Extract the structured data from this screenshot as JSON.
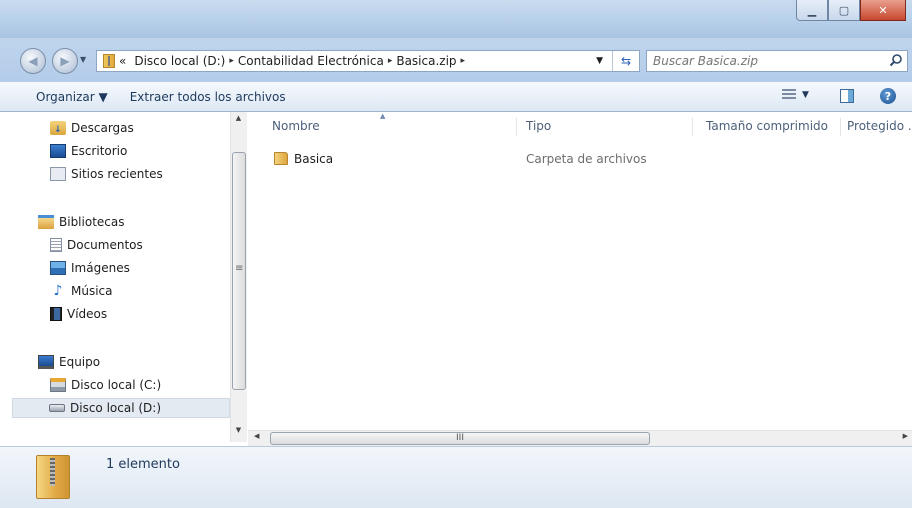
{
  "window": {
    "title": "",
    "minimize_glyph": "▁",
    "maximize_glyph": "▢",
    "close_glyph": "✕"
  },
  "nav": {
    "back_icon": "back-arrow-icon",
    "forward_icon": "forward-arrow-icon"
  },
  "address": {
    "overflow": "«",
    "segments": [
      "Disco local (D:)",
      "Contabilidad Electrónica",
      "Basica.zip"
    ],
    "separator": "▸"
  },
  "search": {
    "placeholder": "Buscar Basica.zip"
  },
  "toolbar": {
    "organize": "Organizar ▼",
    "extract_all": "Extraer todos los archivos",
    "view_dropdown": "▼"
  },
  "sidebar": {
    "items": [
      {
        "label": "Descargas",
        "icon": "downloads-folder-icon"
      },
      {
        "label": "Escritorio",
        "icon": "desktop-icon"
      },
      {
        "label": "Sitios recientes",
        "icon": "recent-places-icon"
      },
      {
        "label": "Bibliotecas",
        "icon": "libraries-icon"
      },
      {
        "label": "Documentos",
        "icon": "documents-icon"
      },
      {
        "label": "Imágenes",
        "icon": "pictures-icon"
      },
      {
        "label": "Música",
        "icon": "music-icon"
      },
      {
        "label": "Vídeos",
        "icon": "videos-icon"
      },
      {
        "label": "Equipo",
        "icon": "computer-icon"
      },
      {
        "label": "Disco local (C:)",
        "icon": "system-drive-icon"
      },
      {
        "label": "Disco local (D:)",
        "icon": "drive-icon",
        "selected": true
      }
    ],
    "scroll_grip": "≡"
  },
  "columns": [
    "Nombre",
    "Tipo",
    "Tamaño comprimido",
    "Protegido ."
  ],
  "files": [
    {
      "name": "Basica",
      "type": "Carpeta de archivos",
      "compressed_size": "",
      "protected": ""
    }
  ],
  "hscroll_grip": "III",
  "status": {
    "count": "1 elemento"
  },
  "colors": {
    "titlebar": "#bcd3ec",
    "toolbar": "#e7eff8",
    "selection": "#e4eaf1",
    "close_button": "#c7472f"
  }
}
